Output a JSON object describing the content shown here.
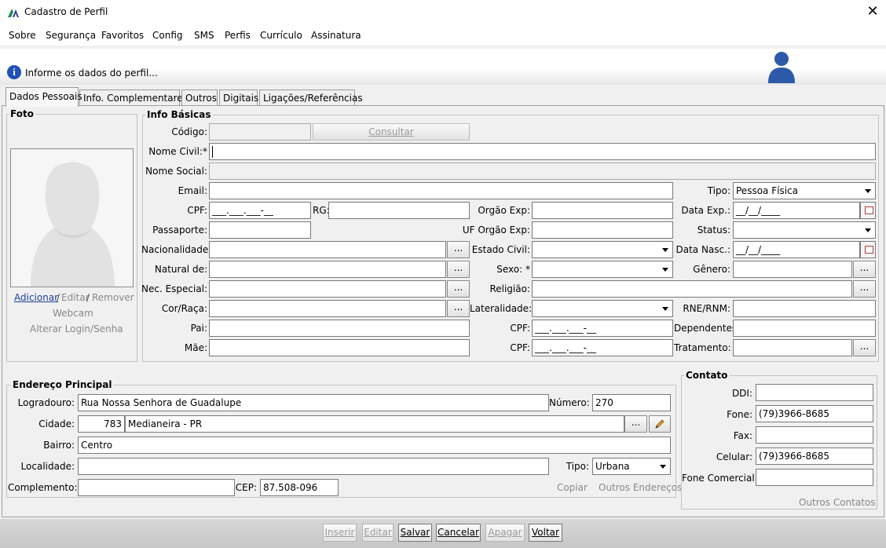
{
  "window": {
    "title": "Cadastro de Perfil",
    "close": "✕"
  },
  "menu": [
    "Sobre",
    "Segurança",
    "Favoritos",
    "Config",
    "SMS",
    "Perfis",
    "Currículo",
    "Assinatura"
  ],
  "banner": {
    "text": "Informe os dados do perfil...",
    "info_glyph": "i"
  },
  "tabs": [
    "Dados Pessoais",
    "Info. Complementares",
    "Outros",
    "Digitais",
    "Ligações/Referências"
  ],
  "foto": {
    "title": "Foto",
    "add": "Adicionar",
    "sep": "/",
    "edit": "Editar",
    "remove": "Remover",
    "webcam": "Webcam",
    "alter_login": "Alterar Login/Senha"
  },
  "info": {
    "title": "Info Básicas",
    "codigo_label": "Código:",
    "consultar": "Consultar",
    "nome_civil_label": "Nome Civil:*",
    "nome_social_label": "Nome Social:",
    "email_label": "Email:",
    "tipo_label": "Tipo:",
    "tipo_value": "Pessoa Física",
    "cpf_label": "CPF:",
    "cpf_mask": "___.___.___-__",
    "rg_label": "RG:",
    "orgao_exp_label": "Orgão Exp:",
    "data_exp_label": "Data Exp.:",
    "date_mask": "__/__/____",
    "passaporte_label": "Passaporte:",
    "uf_orgao_label": "UF Orgão Exp:",
    "status_label": "Status:",
    "nacionalidade_label": "Nacionalidade:",
    "estado_civil_label": "Estado Civil:",
    "data_nasc_label": "Data Nasc.:",
    "natural_label": "Natural de:",
    "sexo_label": "Sexo: *",
    "genero_label": "Gênero:",
    "nec_label": "Nec. Especial:",
    "religiao_label": "Religião:",
    "cor_label": "Cor/Raça:",
    "lateralidade_label": "Lateralidade:",
    "rne_label": "RNE/RNM:",
    "pai_label": "Pai:",
    "cpf2_label": "CPF:",
    "dependentes_label": "Dependentes:",
    "mae_label": "Mãe:",
    "cpf3_label": "CPF:",
    "tratamento_label": "Tratamento:",
    "ellipsis": "..."
  },
  "endereco": {
    "title": "Endereço Principal",
    "logradouro_label": "Logradouro:",
    "logradouro": "Rua Nossa Senhora de Guadalupe",
    "numero_label": "Número:",
    "numero": "270",
    "cidade_label": "Cidade:",
    "cidade_code": "783",
    "cidade": "Medianeira - PR",
    "bairro_label": "Bairro:",
    "bairro": "Centro",
    "localidade_label": "Localidade:",
    "tipo_label": "Tipo:",
    "tipo": "Urbana",
    "complemento_label": "Complemento:",
    "cep_label": "CEP:",
    "cep": "87.508-096",
    "copiar": "Copiar",
    "outros": "Outros Endereços",
    "ellipsis": "..."
  },
  "contato": {
    "title": "Contato",
    "ddi_label": "DDI:",
    "fone_label": "Fone:",
    "fone": "(79)3966-8685",
    "fax_label": "Fax:",
    "celular_label": "Celular:",
    "celular": "(79)3966-8685",
    "fone_comercial_label": "Fone Comercial:",
    "outros": "Outros Contatos"
  },
  "footer": [
    "Inserir",
    "Editar",
    "Salvar",
    "Cancelar",
    "Apagar",
    "Voltar"
  ],
  "colors": {
    "accent": "#2050b8",
    "user_icon": "#2c5aa8",
    "link": "#1a3e9a"
  }
}
